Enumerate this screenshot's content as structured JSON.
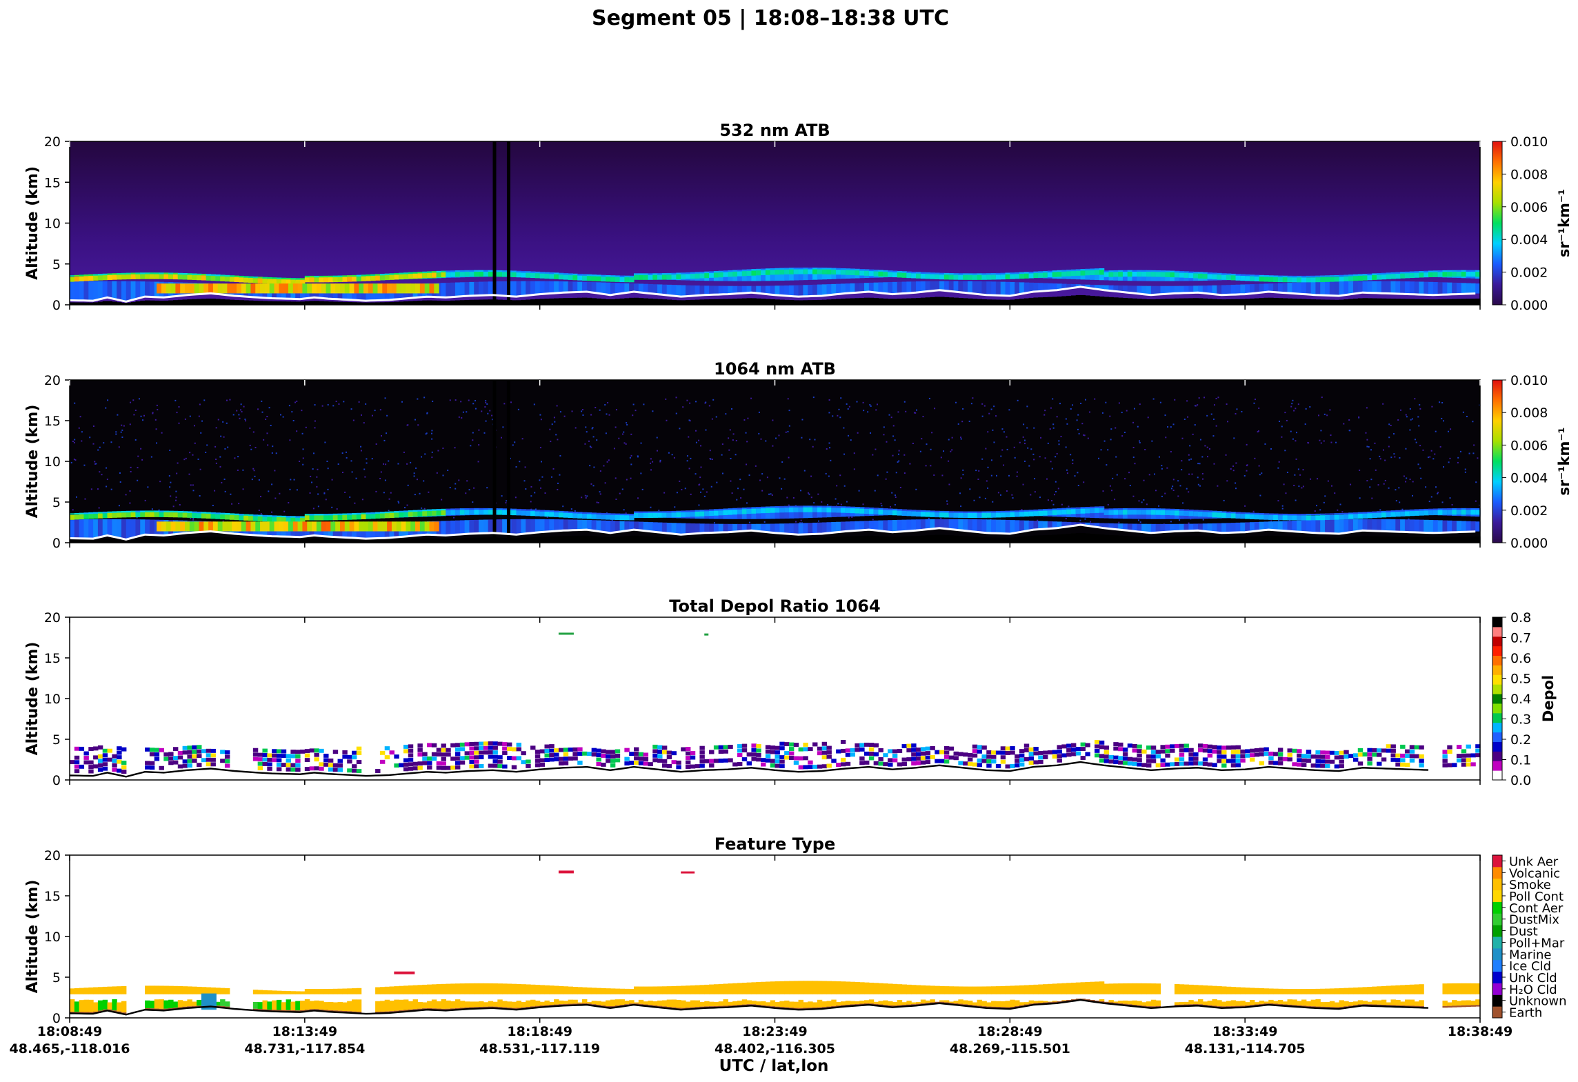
{
  "figure": {
    "suptitle": "Segment 05  |  18:08–18:38 UTC",
    "xlabel": "UTC / lat,lon",
    "ylabel": "Altitude (km)"
  },
  "chart_data": {
    "type": "heatmap",
    "x_ticks": [
      {
        "time": "18:08:49",
        "latlon": "48.465,-118.016"
      },
      {
        "time": "18:13:49",
        "latlon": "48.731,-117.854"
      },
      {
        "time": "18:18:49",
        "latlon": "48.531,-117.119"
      },
      {
        "time": "18:23:49",
        "latlon": "48.402,-116.305"
      },
      {
        "time": "18:28:49",
        "latlon": "48.269,-115.501"
      },
      {
        "time": "18:33:49",
        "latlon": "48.131,-114.705"
      },
      {
        "time": "18:38:49",
        "latlon": ""
      }
    ],
    "xlim_minutes": [
      0,
      30
    ],
    "ylim_km": [
      0,
      20
    ],
    "y_ticks": [
      "0",
      "5",
      "10",
      "15",
      "20"
    ],
    "surface_elevation_km": [
      [
        0,
        0.55
      ],
      [
        0.5,
        0.5
      ],
      [
        0.8,
        0.9
      ],
      [
        1.2,
        0.4
      ],
      [
        1.6,
        1.0
      ],
      [
        2.0,
        0.9
      ],
      [
        2.5,
        1.2
      ],
      [
        3.0,
        1.4
      ],
      [
        3.5,
        1.1
      ],
      [
        4.0,
        0.9
      ],
      [
        4.3,
        0.8
      ],
      [
        4.9,
        0.7
      ],
      [
        5.2,
        0.9
      ],
      [
        5.5,
        0.75
      ],
      [
        6.0,
        0.6
      ],
      [
        6.3,
        0.5
      ],
      [
        6.8,
        0.6
      ],
      [
        7.2,
        0.8
      ],
      [
        7.6,
        1.0
      ],
      [
        8.0,
        0.9
      ],
      [
        8.5,
        1.1
      ],
      [
        9.0,
        1.2
      ],
      [
        9.5,
        1.0
      ],
      [
        10.0,
        1.3
      ],
      [
        10.5,
        1.5
      ],
      [
        11.0,
        1.6
      ],
      [
        11.5,
        1.2
      ],
      [
        12.0,
        1.6
      ],
      [
        12.5,
        1.3
      ],
      [
        13.0,
        1.0
      ],
      [
        13.5,
        1.2
      ],
      [
        14.0,
        1.3
      ],
      [
        14.5,
        1.5
      ],
      [
        15.0,
        1.2
      ],
      [
        15.5,
        1.0
      ],
      [
        16.0,
        1.1
      ],
      [
        16.5,
        1.4
      ],
      [
        17.0,
        1.6
      ],
      [
        17.5,
        1.3
      ],
      [
        18.0,
        1.5
      ],
      [
        18.5,
        1.8
      ],
      [
        19.0,
        1.5
      ],
      [
        19.5,
        1.2
      ],
      [
        20.0,
        1.1
      ],
      [
        20.5,
        1.6
      ],
      [
        21.0,
        1.8
      ],
      [
        21.5,
        2.2
      ],
      [
        22.0,
        1.8
      ],
      [
        22.5,
        1.5
      ],
      [
        23.0,
        1.2
      ],
      [
        23.5,
        1.4
      ],
      [
        24.0,
        1.5
      ],
      [
        24.5,
        1.2
      ],
      [
        25.0,
        1.3
      ],
      [
        25.5,
        1.6
      ],
      [
        26.0,
        1.4
      ],
      [
        26.5,
        1.2
      ],
      [
        27.0,
        1.1
      ],
      [
        27.5,
        1.5
      ],
      [
        28.0,
        1.4
      ],
      [
        28.5,
        1.3
      ],
      [
        29.0,
        1.2
      ],
      [
        29.5,
        1.3
      ],
      [
        30.0,
        1.4
      ]
    ],
    "panels": [
      {
        "id": "atb532",
        "title": "532 nm ATB",
        "colorbar_label": "sr⁻¹km⁻¹",
        "colorbar_ticks": [
          "0.000",
          "0.002",
          "0.004",
          "0.006",
          "0.008",
          "0.010"
        ],
        "colormap": [
          "#2a0a4a",
          "#3b1a9a",
          "#1a5cff",
          "#00d0ff",
          "#00e060",
          "#a8e000",
          "#ffd000",
          "#ff7000",
          "#e01010"
        ],
        "cbar_range": [
          0,
          0.01
        ]
      },
      {
        "id": "atb1064",
        "title": "1064 nm ATB",
        "colorbar_label": "sr⁻¹km⁻¹",
        "colorbar_ticks": [
          "0.000",
          "0.002",
          "0.004",
          "0.006",
          "0.008",
          "0.010"
        ],
        "colormap": [
          "#2a0a4a",
          "#3b1a9a",
          "#1a5cff",
          "#00d0ff",
          "#00e060",
          "#a8e000",
          "#ffd000",
          "#ff7000",
          "#e01010"
        ],
        "cbar_range": [
          0,
          0.01
        ]
      },
      {
        "id": "depol",
        "title": "Total Depol Ratio 1064",
        "colorbar_label": "Depol",
        "colorbar_ticks": [
          "0.0",
          "0.1",
          "0.2",
          "0.3",
          "0.4",
          "0.5",
          "0.6",
          "0.7",
          "0.8"
        ],
        "cbar_range": [
          0,
          0.8
        ],
        "depol_colors": [
          "#ffffff",
          "#c000c0",
          "#4b0082",
          "#0000c8",
          "#2060ff",
          "#00b4ff",
          "#00c850",
          "#80e000",
          "#008000",
          "#b0e000",
          "#ffe000",
          "#ffb000",
          "#ff7000",
          "#ff2000",
          "#c00000",
          "#ff8080",
          "#000000"
        ]
      },
      {
        "id": "ftype",
        "title": "Feature Type",
        "feature_classes": [
          {
            "label": "Earth",
            "color": "#a0522d"
          },
          {
            "label": "Unknown",
            "color": "#000000"
          },
          {
            "label": "H₂O Cld",
            "color": "#9400d3"
          },
          {
            "label": "Unk Cld",
            "color": "#0000cd"
          },
          {
            "label": "Ice Cld",
            "color": "#1e7fff"
          },
          {
            "label": "Marine",
            "color": "#1e90c8"
          },
          {
            "label": "Poll+Mar",
            "color": "#20b2aa"
          },
          {
            "label": "Dust",
            "color": "#00a000"
          },
          {
            "label": "DustMix",
            "color": "#32cd32"
          },
          {
            "label": "Cont Aer",
            "color": "#00d000"
          },
          {
            "label": "Poll Cont",
            "color": "#ffd700"
          },
          {
            "label": "Smoke",
            "color": "#ffc000"
          },
          {
            "label": "Volcanic",
            "color": "#ff8c00"
          },
          {
            "label": "Unk Aer",
            "color": "#dc143c"
          }
        ]
      }
    ]
  }
}
